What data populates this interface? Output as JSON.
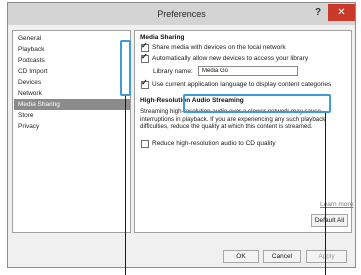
{
  "window": {
    "title": "Preferences",
    "help_glyph": "?",
    "close_glyph": "✕"
  },
  "sidebar": {
    "items": [
      {
        "label": "General"
      },
      {
        "label": "Playback"
      },
      {
        "label": "Podcasts"
      },
      {
        "label": "CD Import"
      },
      {
        "label": "Devices"
      },
      {
        "label": "Network"
      },
      {
        "label": "Media Sharing",
        "selected": true
      },
      {
        "label": "Store"
      },
      {
        "label": "Privacy"
      }
    ]
  },
  "media_sharing": {
    "heading": "Media Sharing",
    "share_checkbox": {
      "checked": true,
      "label": "Share media with devices on the local network"
    },
    "auto_allow_checkbox": {
      "checked": true,
      "label": "Automatically allow new devices to access your library"
    },
    "library_name_label": "Library name:",
    "library_name_value": "Media Go",
    "use_language_checkbox": {
      "checked": true,
      "label": "Use current application language to display content categories"
    }
  },
  "hires": {
    "heading": "High-Resolution Audio Streaming",
    "description": "Streaming high-resolution audio over a slower network may cause interruptions in playback. If you are experiencing any such playback difficulties, reduce the quality at which this content is streamed.",
    "reduce_checkbox": {
      "checked": false,
      "label": "Reduce high-resolution audio to CD quality"
    }
  },
  "panel": {
    "learn_more": "Learn more",
    "default_all": "Default All"
  },
  "footer": {
    "ok": "OK",
    "cancel": "Cancel",
    "apply": "Apply"
  },
  "colors": {
    "titlebar": "#d4d4d4",
    "close_button": "#c8392a",
    "selected_item": "#8b8b8b",
    "callout": "#3f9bd8"
  }
}
